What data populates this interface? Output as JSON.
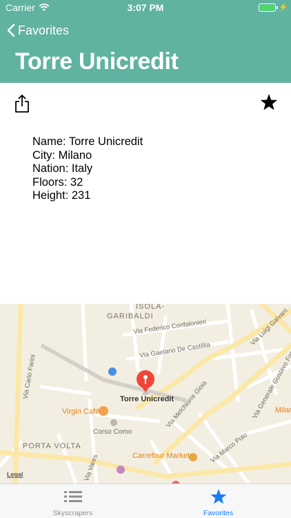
{
  "status_bar": {
    "carrier": "Carrier",
    "time": "3:07 PM"
  },
  "nav": {
    "back_label": "Favorites",
    "title": "Torre Unicredit"
  },
  "details": [
    "Name: Torre Unicredit",
    "City: Milano",
    "Nation: Italy",
    "Floors: 32",
    "Height: 231"
  ],
  "map": {
    "pin_label": "Torre Unicredit",
    "legal": "Legal",
    "labels": {
      "isola": "ISOLA-",
      "garibaldi": "GARIBALDI",
      "confalonieri": "Via Federico Confalonieri",
      "castillia": "Via Gaetano De Castillia",
      "luigi_galvani": "Via Luigi Galvani",
      "carlo_farini": "Via Carlo Farini",
      "melchiorre_gioia": "Via Melchiorre Gioia",
      "gustavo_fara": "Via Generale Gustavo Fara",
      "virgin_cafe": "Virgin Café",
      "corso_como": "Corso Como",
      "porta_volta": "PORTA VOLTA",
      "carrefour": "Carrefour Market",
      "marco_polo": "Via Marco Polo",
      "varese": "Via Vares",
      "milan": "Milar"
    }
  },
  "tabs": [
    {
      "label": "Skyscrapers",
      "active": false
    },
    {
      "label": "Favorites",
      "active": true
    }
  ],
  "colors": {
    "header": "#5fb3a0",
    "tab_active": "#1a7cf5",
    "tab_inactive": "#8e8e93",
    "pin": "#f0463a"
  }
}
